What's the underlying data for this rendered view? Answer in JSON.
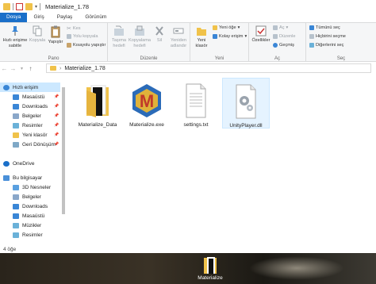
{
  "window": {
    "title": "Materialize_1.78"
  },
  "tabs": [
    "Dosya",
    "Giriş",
    "Paylaş",
    "Görünüm"
  ],
  "ribbon": {
    "pano": {
      "label": "Pano",
      "pin_label": "Hızlı erişime sabitle",
      "copy_label": "Kopyala",
      "paste_label": "Yapıştır",
      "cut_label": "Kes",
      "copy_path_label": "Yolu kopyala",
      "paste_shortcut_label": "Kısayolu yapıştır"
    },
    "duzenle": {
      "label": "Düzenle",
      "move_label": "Taşıma hedefi",
      "copyto_label": "Kopyalama hedefi",
      "delete_label": "Sil",
      "rename_label": "Yeniden adlandır"
    },
    "yeni": {
      "label": "Yeni",
      "new_folder_label": "Yeni klasör",
      "new_item_label": "Yeni öğe",
      "easy_access_label": "Kolay erişim"
    },
    "ac": {
      "label": "Aç",
      "properties_label": "Özellikler",
      "open_label": "Aç",
      "edit_label": "Düzenle",
      "history_label": "Geçmiş"
    },
    "sec": {
      "label": "Seç",
      "select_all_label": "Tümünü seç",
      "select_none_label": "Hiçbirini seçme",
      "invert_label": "Diğerlerini seç"
    }
  },
  "address": {
    "path": "Materialize_1.78"
  },
  "nav": {
    "items": [
      {
        "label": "Hızlı erişim",
        "icon": "star-icon",
        "color": "#3a86d6",
        "pinned": false,
        "selected": true,
        "indent": 0
      },
      {
        "label": "Masaüstü",
        "icon": "desktop-folder-icon",
        "color": "#3a86d6",
        "pinned": true,
        "selected": false,
        "indent": 1
      },
      {
        "label": "Downloads",
        "icon": "downloads-folder-icon",
        "color": "#3a86d6",
        "pinned": true,
        "selected": false,
        "indent": 1
      },
      {
        "label": "Belgeler",
        "icon": "documents-folder-icon",
        "color": "#8aa7c9",
        "pinned": true,
        "selected": false,
        "indent": 1
      },
      {
        "label": "Resimler",
        "icon": "pictures-folder-icon",
        "color": "#6bb1d8",
        "pinned": true,
        "selected": false,
        "indent": 1
      },
      {
        "label": "Yeni klasör",
        "icon": "folder-icon",
        "color": "#f0c24a",
        "pinned": true,
        "selected": false,
        "indent": 1
      },
      {
        "label": "Geri Dönüşüm",
        "icon": "recycle-bin-icon",
        "color": "#7fa8c6",
        "pinned": true,
        "selected": false,
        "indent": 1
      },
      {
        "label": "OneDrive",
        "icon": "onedrive-icon",
        "color": "#1a6fc9",
        "pinned": false,
        "selected": false,
        "indent": 0
      },
      {
        "label": "Bu bilgisayar",
        "icon": "computer-icon",
        "color": "#4a90d9",
        "pinned": false,
        "selected": false,
        "indent": 0
      },
      {
        "label": "3D Nesneler",
        "icon": "3d-objects-icon",
        "color": "#5aa0e0",
        "pinned": false,
        "selected": false,
        "indent": 1
      },
      {
        "label": "Belgeler",
        "icon": "documents-folder-icon",
        "color": "#8aa7c9",
        "pinned": false,
        "selected": false,
        "indent": 1
      },
      {
        "label": "Downloads",
        "icon": "downloads-folder-icon",
        "color": "#3a86d6",
        "pinned": false,
        "selected": false,
        "indent": 1
      },
      {
        "label": "Masaüstü",
        "icon": "desktop-folder-icon",
        "color": "#3a86d6",
        "pinned": false,
        "selected": false,
        "indent": 1
      },
      {
        "label": "Müzikler",
        "icon": "music-folder-icon",
        "color": "#6bb1d8",
        "pinned": false,
        "selected": false,
        "indent": 1
      },
      {
        "label": "Resimler",
        "icon": "pictures-folder-icon",
        "color": "#6bb1d8",
        "pinned": false,
        "selected": false,
        "indent": 1
      }
    ]
  },
  "files": [
    {
      "name": "Materialize_Data",
      "icon": "folder-icon",
      "selected": false
    },
    {
      "name": "Materialize.exe",
      "icon": "materialize-app-icon",
      "selected": false
    },
    {
      "name": "settings.txt",
      "icon": "text-file-icon",
      "selected": false
    },
    {
      "name": "UnityPlayer.dll",
      "icon": "dll-file-icon",
      "selected": true
    }
  ],
  "status": {
    "item_count": "4 öğe"
  },
  "desktop": {
    "shortcut_label": "Materialize"
  },
  "colors": {
    "accent": "#1a6fc9",
    "selection": "#cce8ff",
    "folder": "#f0c24a"
  }
}
